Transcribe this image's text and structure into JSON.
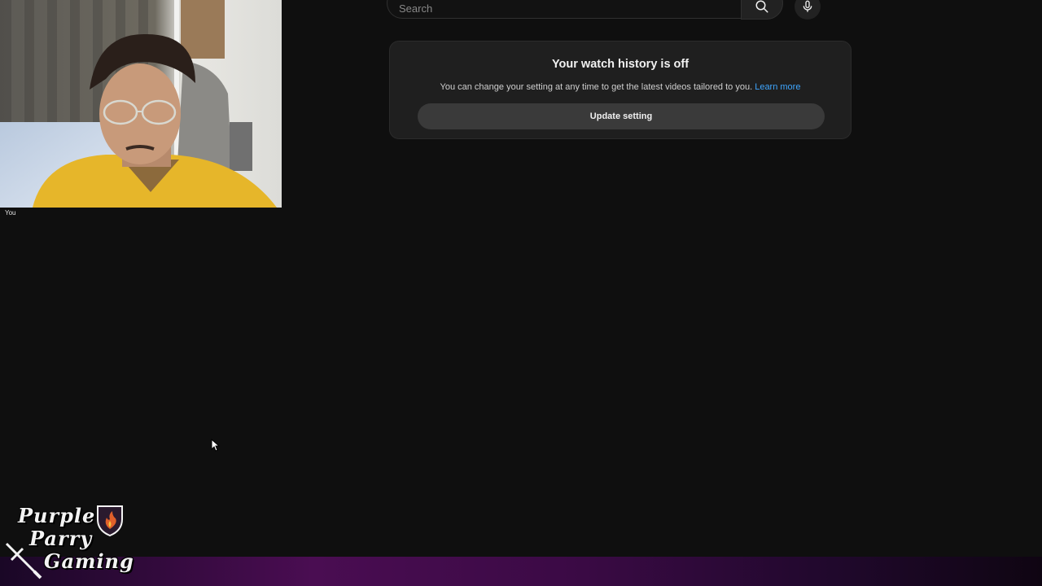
{
  "search": {
    "placeholder": "Search"
  },
  "history_card": {
    "title": "Your watch history is off",
    "description": "You can change your setting at any time to get the latest videos tailored to you.",
    "learn_more": "Learn more",
    "button_label": "Update setting"
  },
  "webcam": {
    "label": "You"
  },
  "channel_logo": {
    "line1": "Purple",
    "line2": "Parry",
    "line3": "Gaming"
  },
  "colors": {
    "background": "#0f0f0f",
    "card": "#1f1f1f",
    "link": "#3ea6ff",
    "button": "#3a3a3a",
    "glow": "#4a0d52"
  },
  "icons": {
    "search": "search-icon",
    "mic": "microphone-icon",
    "cursor": "mouse-pointer-icon",
    "shield": "flaming-shield-icon",
    "sword": "sword-icon"
  }
}
